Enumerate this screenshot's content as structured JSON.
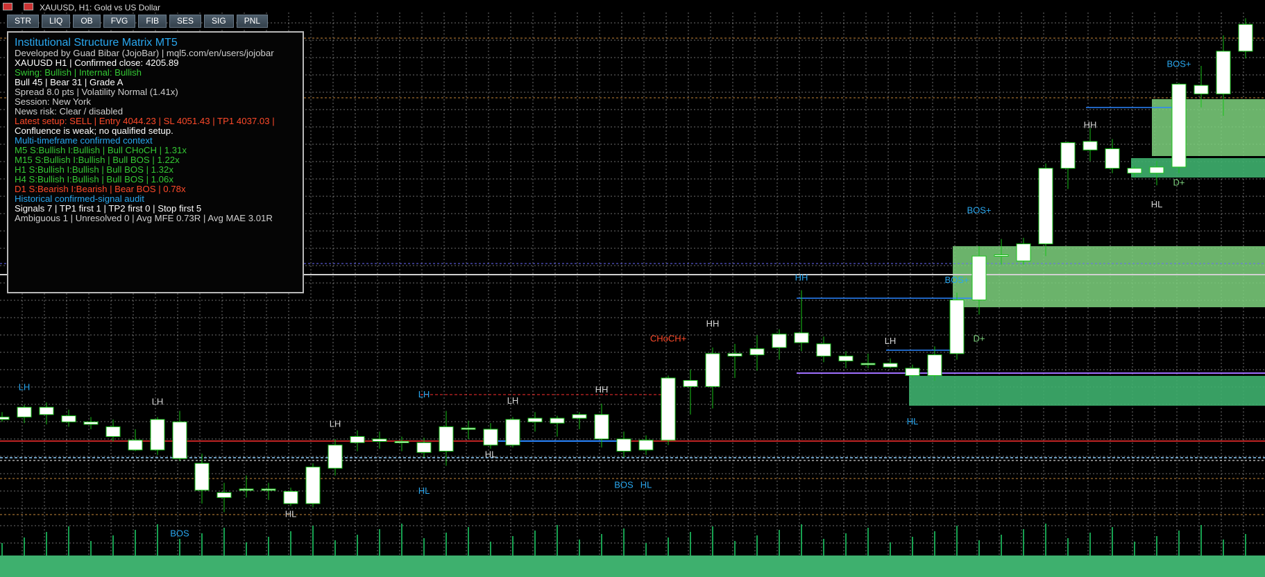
{
  "window": {
    "symbol_caption": "XAUUSD, H1:  Gold vs US Dollar"
  },
  "toolbar": {
    "buttons": [
      "STR",
      "LIQ",
      "OB",
      "FVG",
      "FIB",
      "SES",
      "SIG",
      "PNL"
    ]
  },
  "panel": {
    "title": "Institutional Structure Matrix MT5",
    "lines": [
      {
        "text": "Developed by Guad Bibar (JojoBar) | mql5.com/en/users/jojobar",
        "color": "#cfcfcf"
      },
      {
        "text": "XAUUSD H1 | Confirmed close: 4205.89",
        "color": "#ffffff"
      },
      {
        "text": "Swing: Bullish | Internal: Bullish",
        "color": "#34c934"
      },
      {
        "text": "Bull 45 | Bear 31 | Grade A",
        "color": "#ffffff"
      },
      {
        "text": "Spread 8.0 pts | Volatility Normal (1.41x)",
        "color": "#cfcfcf"
      },
      {
        "text": "Session: New York",
        "color": "#cfcfcf"
      },
      {
        "text": "News risk: Clear / disabled",
        "color": "#cfcfcf"
      },
      {
        "text": "Latest setup: SELL | Entry 4044.23 | SL 4051.43 | TP1 4037.03 |",
        "color": "#ff4a2a"
      },
      {
        "text": "Confluence is weak; no qualified setup.",
        "color": "#ffffff"
      },
      {
        "text": "Multi-timeframe confirmed context",
        "color": "#29a7ef"
      },
      {
        "text": "M5  S:Bullish I:Bullish | Bull CHoCH | 1.31x",
        "color": "#34c934"
      },
      {
        "text": "M15  S:Bullish I:Bullish | Bull BOS | 1.22x",
        "color": "#34c934"
      },
      {
        "text": "H1  S:Bullish I:Bullish | Bull BOS | 1.32x",
        "color": "#34c934"
      },
      {
        "text": "H4  S:Bullish I:Bullish | Bull BOS | 1.06x",
        "color": "#34c934"
      },
      {
        "text": "D1  S:Bearish I:Bearish | Bear BOS | 0.78x",
        "color": "#ff4a2a"
      },
      {
        "text": "Historical confirmed-signal audit",
        "color": "#29a7ef"
      },
      {
        "text": "Signals 7 | TP1 first 1 | TP2 first 0 | Stop first 5",
        "color": "#ffffff"
      },
      {
        "text": "Ambiguous 1 | Unresolved 0 | Avg MFE 0.73R | Avg MAE 3.01R",
        "color": "#cfcfcf"
      }
    ]
  },
  "chart_data": {
    "type": "candlestick",
    "symbol": "XAUUSD",
    "timeframe": "H1",
    "candles": [
      {
        "o": 4058,
        "h": 4062,
        "l": 4054,
        "c": 4056
      },
      {
        "o": 4058,
        "h": 4068,
        "l": 4053,
        "c": 4066
      },
      {
        "o": 4066,
        "h": 4070,
        "l": 4052,
        "c": 4060
      },
      {
        "o": 4059,
        "h": 4064,
        "l": 4050,
        "c": 4054
      },
      {
        "o": 4054,
        "h": 4058,
        "l": 4048,
        "c": 4052
      },
      {
        "o": 4050,
        "h": 4056,
        "l": 4038,
        "c": 4042
      },
      {
        "o": 4039,
        "h": 4048,
        "l": 4030,
        "c": 4031
      },
      {
        "o": 4031,
        "h": 4058,
        "l": 4027,
        "c": 4056
      },
      {
        "o": 4054,
        "h": 4063,
        "l": 4022,
        "c": 4024
      },
      {
        "o": 4020,
        "h": 4028,
        "l": 3987,
        "c": 3998
      },
      {
        "o": 3996,
        "h": 4004,
        "l": 3980,
        "c": 3992
      },
      {
        "o": 3998,
        "h": 4010,
        "l": 3992,
        "c": 3999
      },
      {
        "o": 3999,
        "h": 4004,
        "l": 3990,
        "c": 3998
      },
      {
        "o": 3997,
        "h": 4000,
        "l": 3985,
        "c": 3987
      },
      {
        "o": 3987,
        "h": 4020,
        "l": 3984,
        "c": 4017
      },
      {
        "o": 4016,
        "h": 4040,
        "l": 4010,
        "c": 4035
      },
      {
        "o": 4037,
        "h": 4047,
        "l": 4030,
        "c": 4042
      },
      {
        "o": 4040,
        "h": 4046,
        "l": 4032,
        "c": 4038
      },
      {
        "o": 4038,
        "h": 4042,
        "l": 4030,
        "c": 4037
      },
      {
        "o": 4037,
        "h": 4041,
        "l": 4025,
        "c": 4029
      },
      {
        "o": 4030,
        "h": 4063,
        "l": 4018,
        "c": 4050
      },
      {
        "o": 4049,
        "h": 4055,
        "l": 4040,
        "c": 4049
      },
      {
        "o": 4048,
        "h": 4053,
        "l": 4032,
        "c": 4035
      },
      {
        "o": 4035,
        "h": 4058,
        "l": 4033,
        "c": 4056
      },
      {
        "o": 4057,
        "h": 4062,
        "l": 4046,
        "c": 4054
      },
      {
        "o": 4053,
        "h": 4059,
        "l": 4042,
        "c": 4057
      },
      {
        "o": 4057,
        "h": 4062,
        "l": 4048,
        "c": 4060
      },
      {
        "o": 4060,
        "h": 4069,
        "l": 4033,
        "c": 4040
      },
      {
        "o": 4040,
        "h": 4046,
        "l": 4025,
        "c": 4030
      },
      {
        "o": 4031,
        "h": 4043,
        "l": 4027,
        "c": 4039
      },
      {
        "o": 4039,
        "h": 4092,
        "l": 4035,
        "c": 4090
      },
      {
        "o": 4088,
        "h": 4097,
        "l": 4060,
        "c": 4083
      },
      {
        "o": 4083,
        "h": 4115,
        "l": 4065,
        "c": 4110
      },
      {
        "o": 4110,
        "h": 4118,
        "l": 4090,
        "c": 4108
      },
      {
        "o": 4109,
        "h": 4125,
        "l": 4096,
        "c": 4114
      },
      {
        "o": 4115,
        "h": 4130,
        "l": 4105,
        "c": 4126
      },
      {
        "o": 4127,
        "h": 4162,
        "l": 4112,
        "c": 4119
      },
      {
        "o": 4118,
        "h": 4124,
        "l": 4103,
        "c": 4108
      },
      {
        "o": 4108,
        "h": 4112,
        "l": 4098,
        "c": 4104
      },
      {
        "o": 4102,
        "h": 4110,
        "l": 4098,
        "c": 4102
      },
      {
        "o": 4102,
        "h": 4106,
        "l": 4098,
        "c": 4099
      },
      {
        "o": 4098,
        "h": 4101,
        "l": 4090,
        "c": 4092
      },
      {
        "o": 4092,
        "h": 4116,
        "l": 4088,
        "c": 4109
      },
      {
        "o": 4110,
        "h": 4160,
        "l": 4105,
        "c": 4154
      },
      {
        "o": 4154,
        "h": 4198,
        "l": 4142,
        "c": 4190
      },
      {
        "o": 4190,
        "h": 4204,
        "l": 4183,
        "c": 4191
      },
      {
        "o": 4186,
        "h": 4205,
        "l": 4183,
        "c": 4200
      },
      {
        "o": 4200,
        "h": 4266,
        "l": 4190,
        "c": 4262
      },
      {
        "o": 4262,
        "h": 4284,
        "l": 4245,
        "c": 4283
      },
      {
        "o": 4284,
        "h": 4295,
        "l": 4268,
        "c": 4277
      },
      {
        "o": 4278,
        "h": 4286,
        "l": 4258,
        "c": 4262
      },
      {
        "o": 4262,
        "h": 4264,
        "l": 4255,
        "c": 4258
      },
      {
        "o": 4258,
        "h": 4268,
        "l": 4248,
        "c": 4263
      },
      {
        "o": 4263,
        "h": 4332,
        "l": 4258,
        "c": 4331
      },
      {
        "o": 4330,
        "h": 4346,
        "l": 4312,
        "c": 4323
      },
      {
        "o": 4323,
        "h": 4371,
        "l": 4305,
        "c": 4358
      },
      {
        "o": 4358,
        "h": 4385,
        "l": 4352,
        "c": 4380
      }
    ],
    "labels": [
      {
        "text": "LH",
        "bar": 1,
        "price": 4080,
        "color": "#29a7ef"
      },
      {
        "text": "LH",
        "bar": 7,
        "price": 4068,
        "color": "#d6d6d6"
      },
      {
        "text": "BOS",
        "bar": 8,
        "price": 3960,
        "color": "#29a7ef"
      },
      {
        "text": "LH",
        "bar": 15,
        "price": 4050,
        "color": "#d6d6d6"
      },
      {
        "text": "HL",
        "bar": 13,
        "price": 3976,
        "color": "#d6d6d6"
      },
      {
        "text": "LH",
        "bar": 19,
        "price": 4074,
        "color": "#29a7ef"
      },
      {
        "text": "HL",
        "bar": 19,
        "price": 3995,
        "color": "#29a7ef"
      },
      {
        "text": "LH",
        "bar": 23,
        "price": 4069,
        "color": "#d6d6d6"
      },
      {
        "text": "HL",
        "bar": 22,
        "price": 4025,
        "color": "#d6d6d6"
      },
      {
        "text": "HH",
        "bar": 27,
        "price": 4078,
        "color": "#d6d6d6"
      },
      {
        "text": "BOS",
        "bar": 28,
        "price": 4000,
        "color": "#29a7ef"
      },
      {
        "text": "HL",
        "bar": 29,
        "price": 4000,
        "color": "#29a7ef"
      },
      {
        "text": "CHoCH+",
        "bar": 30,
        "price": 4120,
        "color": "#ff4a2a"
      },
      {
        "text": "HH",
        "bar": 32,
        "price": 4132,
        "color": "#d6d6d6"
      },
      {
        "text": "HH",
        "bar": 36,
        "price": 4170,
        "color": "#29a7ef"
      },
      {
        "text": "LH",
        "bar": 40,
        "price": 4118,
        "color": "#d6d6d6"
      },
      {
        "text": "HL",
        "bar": 41,
        "price": 4052,
        "color": "#29a7ef"
      },
      {
        "text": "BOS+",
        "bar": 43,
        "price": 4168,
        "color": "#29a7ef"
      },
      {
        "text": "D+",
        "bar": 44,
        "price": 4120,
        "color": "#7ed27e"
      },
      {
        "text": "BOS+",
        "bar": 44,
        "price": 4225,
        "color": "#29a7ef"
      },
      {
        "text": "HH",
        "bar": 49,
        "price": 4295,
        "color": "#d6d6d6"
      },
      {
        "text": "HL",
        "bar": 52,
        "price": 4230,
        "color": "#d6d6d6"
      },
      {
        "text": "D+",
        "bar": 53,
        "price": 4248,
        "color": "#7ed27e"
      },
      {
        "text": "BOS+",
        "bar": 53,
        "price": 4345,
        "color": "#29a7ef"
      }
    ]
  },
  "colors": {
    "background": "#000000",
    "grid": "#c8c8c8",
    "bull_candle": "#ffffff",
    "bear_candle": "#ffffff",
    "candle_outline": "#19c519",
    "zone": "#7ed27e",
    "zone_dark": "#3eb06e",
    "blue_line": "#2a86ff",
    "red_line": "#ff3030",
    "violet_line": "#a070ff",
    "volume": "#1fd66a"
  }
}
